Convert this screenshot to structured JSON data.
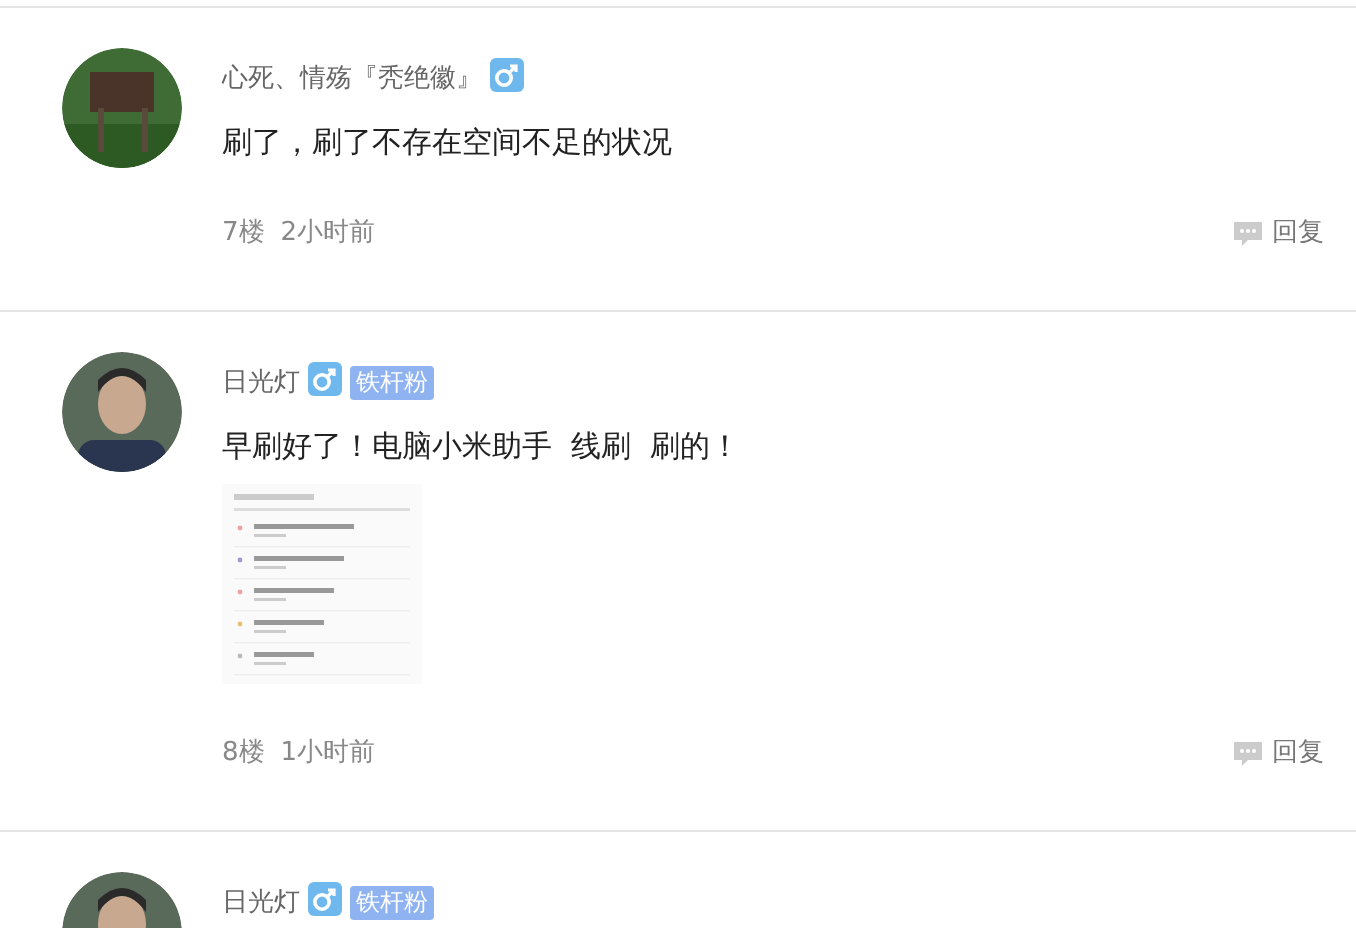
{
  "posts": [
    {
      "author": "心死、情殇『秃绝徽』",
      "content": "刷了，刷了不存在空间不足的状况",
      "floor": "7楼",
      "time": "2小时前",
      "reply": "回复"
    },
    {
      "author": "日光灯",
      "badge": "铁杆粉",
      "content": "早刷好了！电脑小米助手  线刷  刷的！",
      "has_image": true,
      "floor": "8楼",
      "time": "1小时前",
      "reply": "回复"
    },
    {
      "author": "日光灯",
      "badge": "铁杆粉"
    }
  ]
}
